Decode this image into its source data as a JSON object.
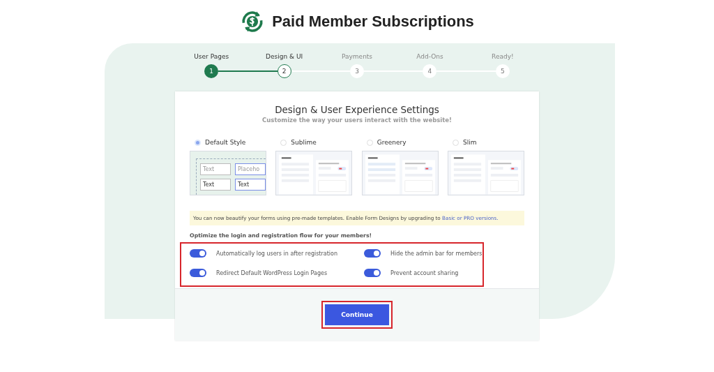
{
  "header": {
    "title": "Paid Member Subscriptions"
  },
  "steps": [
    {
      "label": "User Pages",
      "number": "1",
      "completed": true,
      "selected": false
    },
    {
      "label": "Design & UI",
      "number": "2",
      "completed": false,
      "selected": true
    },
    {
      "label": "Payments",
      "number": "3",
      "completed": false,
      "selected": false
    },
    {
      "label": "Add-Ons",
      "number": "4",
      "completed": false,
      "selected": false
    },
    {
      "label": "Ready!",
      "number": "5",
      "completed": false,
      "selected": false
    }
  ],
  "card": {
    "title": "Design & User Experience Settings",
    "subtitle": "Customize the way your users interact with the website!"
  },
  "styles": [
    {
      "label": "Default Style",
      "selected": true,
      "kind": "fields",
      "preview_texts": [
        "Text",
        "Placeho",
        "Text",
        "Text"
      ]
    },
    {
      "label": "Sublime",
      "selected": false,
      "kind": "mockup"
    },
    {
      "label": "Greenery",
      "selected": false,
      "kind": "mockup"
    },
    {
      "label": "Slim",
      "selected": false,
      "kind": "mockup"
    }
  ],
  "notice": {
    "text": "You can now beautify your forms using pre-made templates. Enable Form Designs by upgrading to",
    "link": "Basic or PRO versions."
  },
  "options": {
    "heading": "Optimize the login and registration flow for your members!",
    "highlighted": true,
    "toggles": [
      {
        "label": "Automatically log users in after registration",
        "on": true
      },
      {
        "label": "Hide the admin bar for members",
        "on": true
      },
      {
        "label": "Redirect Default WordPress Login Pages",
        "on": true
      },
      {
        "label": "Prevent account sharing",
        "on": true
      }
    ]
  },
  "continue_button": {
    "label": "Continue",
    "highlighted": true
  }
}
